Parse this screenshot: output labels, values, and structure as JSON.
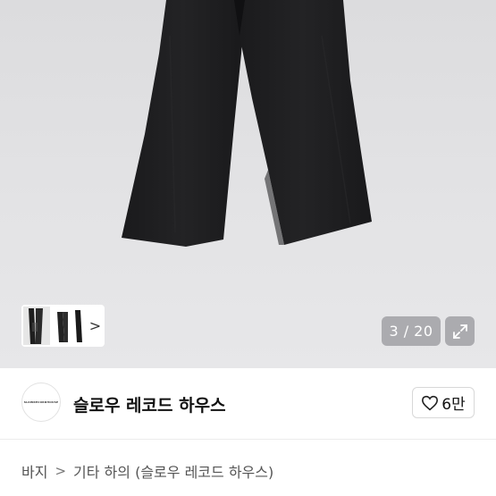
{
  "gallery": {
    "counter_text": "3 / 20",
    "thumb_chevron": ">",
    "image_subject": "black wide-leg trousers"
  },
  "seller": {
    "avatar_text": "SLOWRECORDHOUSE",
    "name": "슬로우 레코드 하우스",
    "likes_text": "6만"
  },
  "breadcrumb": {
    "items": [
      "바지",
      "기타 하의 (슬로우 레코드 하우스)"
    ],
    "separator": ">"
  },
  "colors": {
    "photo_bg": "#e1e1e3",
    "fabric": "#1c1c1e",
    "badge_bg": "#a0a0a5"
  },
  "icons": {
    "like": "heart-icon",
    "expand": "expand-icon",
    "next": "chevron-right-icon"
  }
}
